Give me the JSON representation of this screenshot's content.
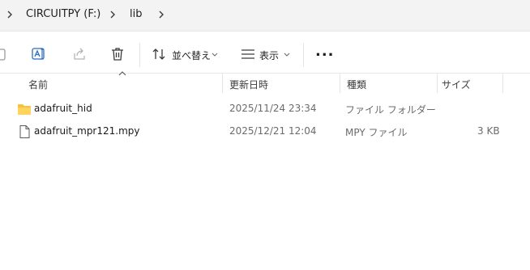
{
  "breadcrumb": {
    "drive": "CIRCUITPY (F:)",
    "folder": "lib"
  },
  "toolbar": {
    "sort_label": "並べ替え",
    "view_label": "表示",
    "more_label": "..."
  },
  "columns": {
    "name": "名前",
    "modified": "更新日時",
    "type": "種類",
    "size": "サイズ"
  },
  "files": [
    {
      "name": "adafruit_hid",
      "modified": "2025/11/24 23:34",
      "type": "ファイル フォルダー",
      "size": "",
      "icon": "folder-icon"
    },
    {
      "name": "adafruit_mpr121.mpy",
      "modified": "2025/12/21 12:04",
      "type": "MPY ファイル",
      "size": "3 KB",
      "icon": "file-icon"
    }
  ],
  "colors": {
    "folder": "#f4c23d",
    "accent_blue": "#2b6cc4"
  }
}
